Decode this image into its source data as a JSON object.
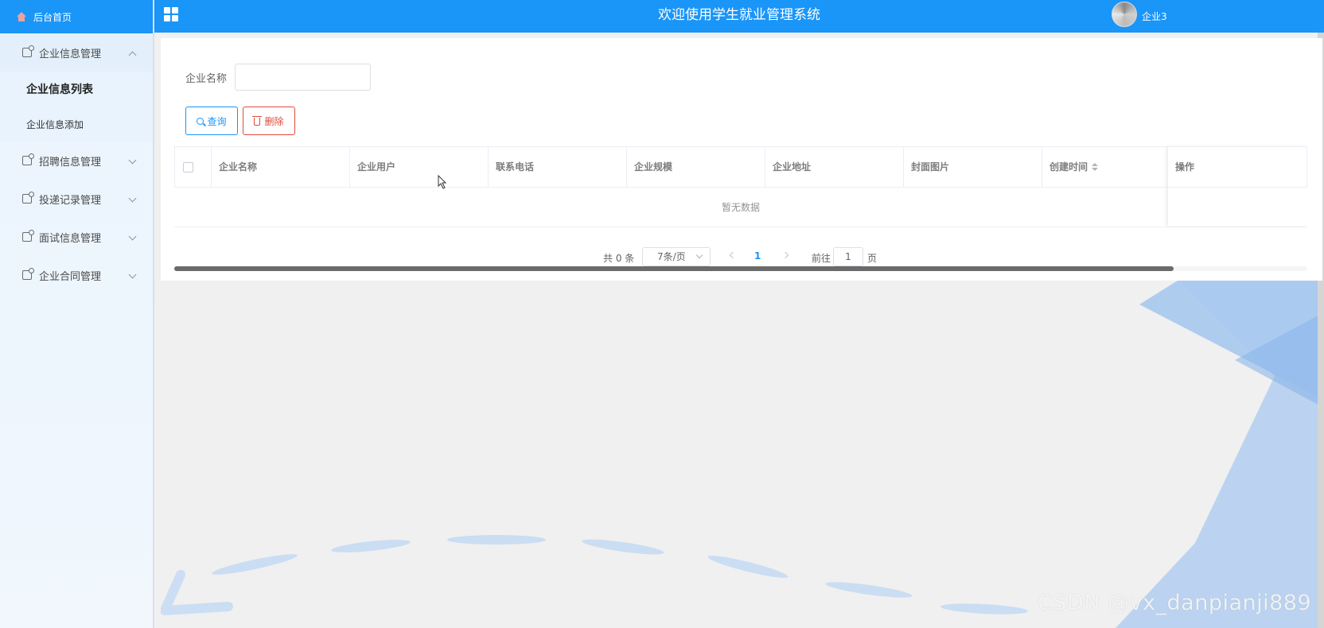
{
  "sidebar": {
    "home_label": "后台首页",
    "menus": [
      {
        "label": "企业信息管理",
        "open": true,
        "children": [
          "企业信息列表",
          "企业信息添加"
        ]
      },
      {
        "label": "招聘信息管理"
      },
      {
        "label": "投递记录管理"
      },
      {
        "label": "面试信息管理"
      },
      {
        "label": "企业合同管理"
      }
    ]
  },
  "header": {
    "title": "欢迎使用学生就业管理系统",
    "username": "企业3"
  },
  "search": {
    "label": "企业名称",
    "value": "",
    "placeholder": ""
  },
  "toolbar": {
    "query_label": "查询",
    "delete_label": "删除"
  },
  "table": {
    "columns": [
      "企业名称",
      "企业用户",
      "联系电话",
      "企业规模",
      "企业地址",
      "封面图片",
      "创建时间",
      "操作"
    ],
    "empty_text": "暂无数据"
  },
  "pagination": {
    "total_text": "共 0 条",
    "page_size": "7条/页",
    "current_page": "1",
    "goto_label": "前往",
    "goto_value": "1",
    "goto_suffix": "页"
  },
  "watermark": "CSDN @vx_danpianji889",
  "colors": {
    "primary": "#1a95f8",
    "danger": "#e04a3a",
    "sidebar_bg": "#eaf4fd"
  }
}
